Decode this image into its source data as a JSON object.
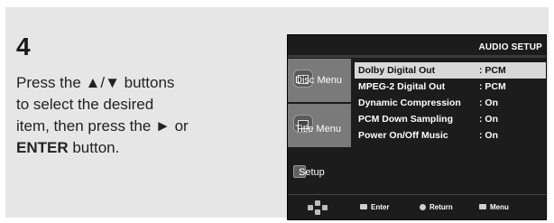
{
  "step": {
    "number": "4",
    "text_line1": "Press the ▲/▼ buttons",
    "text_line2": "to select the desired",
    "text_line3": "item, then press the ► or",
    "text_line4_bold": "ENTER",
    "text_line4_rest": " button."
  },
  "screen": {
    "title": "AUDIO SETUP",
    "sidebar": [
      {
        "label": "Disc Menu",
        "icon": "disc-icon",
        "active": false
      },
      {
        "label": "Title Menu",
        "icon": "title-icon",
        "active": false
      },
      {
        "label": "Setup",
        "icon": "setup-icon",
        "active": true
      }
    ],
    "menu": [
      {
        "label": "Dolby Digital Out",
        "value": ": PCM",
        "selected": true
      },
      {
        "label": "MPEG-2 Digital Out",
        "value": ": PCM",
        "selected": false
      },
      {
        "label": "Dynamic Compression",
        "value": ": On",
        "selected": false
      },
      {
        "label": "PCM Down Sampling",
        "value": ": On",
        "selected": false
      },
      {
        "label": "Power On/Off Music",
        "value": ": On",
        "selected": false
      }
    ],
    "footer": {
      "enter_label": "Enter",
      "return_label": "Return",
      "menu_label": "Menu"
    }
  }
}
